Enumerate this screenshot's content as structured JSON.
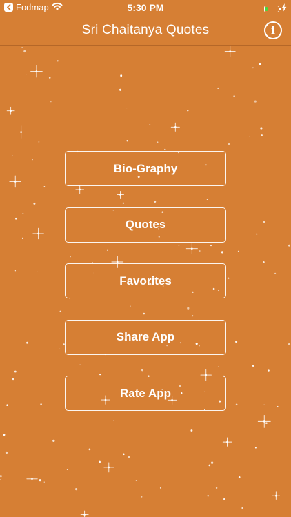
{
  "status_bar": {
    "back_app": "Fodmap",
    "time": "5:30 PM",
    "icons": [
      "back-chevron-icon",
      "wifi-icon",
      "battery-icon",
      "charging-bolt-icon"
    ],
    "battery_level": 0.15
  },
  "nav": {
    "title": "Sri Chaitanya Quotes",
    "info_icon": "info-icon",
    "info_glyph": "i"
  },
  "menu": {
    "items": [
      {
        "label": "Bio-Graphy"
      },
      {
        "label": "Quotes"
      },
      {
        "label": "Favorites"
      },
      {
        "label": "Share App"
      },
      {
        "label": "Rate App"
      }
    ]
  },
  "colors": {
    "background": "#D67F34",
    "text": "#FFFFFF",
    "battery": "#46D93F"
  }
}
